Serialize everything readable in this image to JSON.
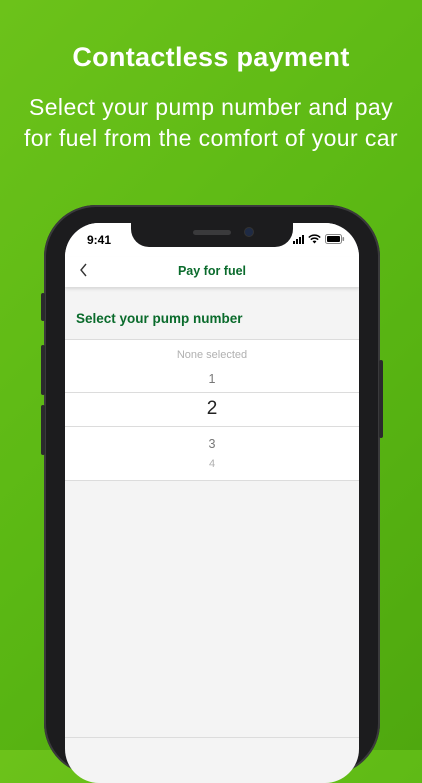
{
  "promo": {
    "headline": "Contactless payment",
    "subline": "Select your pump number and pay for fuel from the comfort of your car"
  },
  "status_bar": {
    "time": "9:41"
  },
  "nav": {
    "back_icon": "chevron-left-icon",
    "title": "Pay for fuel"
  },
  "section": {
    "title": "Select your pump number"
  },
  "picker": {
    "options": [
      "None selected",
      "1",
      "2",
      "3",
      "4"
    ],
    "selected": "2"
  },
  "colors": {
    "brand_green": "#5bb814",
    "title_green": "#0a6b2c"
  }
}
